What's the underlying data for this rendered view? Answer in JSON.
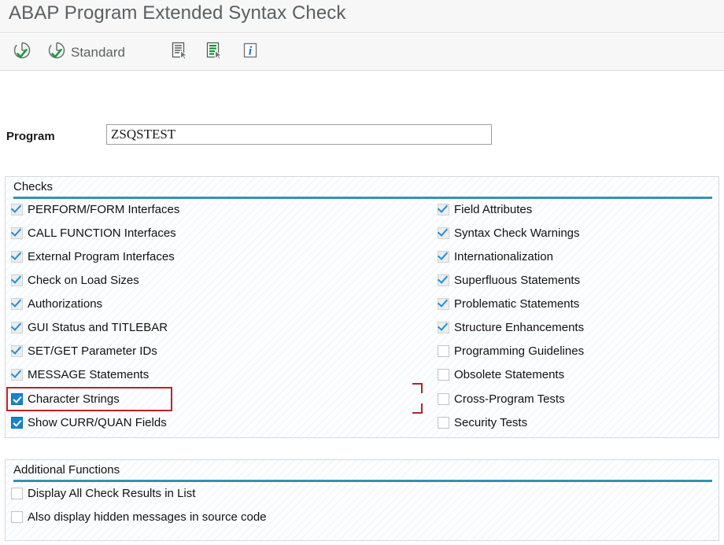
{
  "window": {
    "title": "ABAP Program Extended Syntax Check"
  },
  "toolbar": {
    "items": [
      {
        "name": "execute-check-button",
        "icon": "clock-check-icon",
        "label": ""
      },
      {
        "name": "standard-check-button",
        "icon": "clock-check-icon",
        "label": "Standard"
      },
      {
        "name": "display-list-button",
        "icon": "list-select-icon",
        "label": ""
      },
      {
        "name": "display-green-list-button",
        "icon": "green-list-select-icon",
        "label": ""
      },
      {
        "name": "information-button",
        "icon": "info-icon",
        "label": ""
      }
    ]
  },
  "program": {
    "label": "Program",
    "value": "ZSQSTEST",
    "placeholder": ""
  },
  "checks_panel": {
    "title": "Checks",
    "left_column": [
      {
        "label": "PERFORM/FORM Interfaces",
        "state": "checked"
      },
      {
        "label": "CALL FUNCTION Interfaces",
        "state": "checked"
      },
      {
        "label": "External Program Interfaces",
        "state": "checked"
      },
      {
        "label": "Check on Load Sizes",
        "state": "checked"
      },
      {
        "label": "Authorizations",
        "state": "checked"
      },
      {
        "label": "GUI Status and TITLEBAR",
        "state": "checked"
      },
      {
        "label": "SET/GET Parameter IDs",
        "state": "checked"
      },
      {
        "label": "MESSAGE Statements",
        "state": "checked"
      },
      {
        "label": "Character Strings",
        "state": "selected"
      },
      {
        "label": "Show CURR/QUAN Fields",
        "state": "selected"
      }
    ],
    "right_column": [
      {
        "label": "Field Attributes",
        "state": "checked"
      },
      {
        "label": "Syntax Check Warnings",
        "state": "checked"
      },
      {
        "label": "Internationalization",
        "state": "checked"
      },
      {
        "label": "Superfluous Statements",
        "state": "checked"
      },
      {
        "label": "Problematic Statements",
        "state": "checked"
      },
      {
        "label": "Structure Enhancements",
        "state": "checked"
      },
      {
        "label": "Programming Guidelines",
        "state": "unchecked"
      },
      {
        "label": "Obsolete Statements",
        "state": "unchecked"
      },
      {
        "label": "Cross-Program Tests",
        "state": "unchecked"
      },
      {
        "label": "Security Tests",
        "state": "unchecked"
      }
    ]
  },
  "additional_panel": {
    "title": "Additional Functions",
    "items": [
      {
        "label": "Display All Check Results in List",
        "state": "unchecked"
      },
      {
        "label": "Also display hidden messages in source code",
        "state": "unchecked"
      }
    ]
  },
  "annotation": {
    "highlight_color": "#c0202a",
    "target": "Character Strings"
  },
  "colors": {
    "accent_rule": "#3494ad",
    "checkbox_tick": "#1f8fd4",
    "checkbox_selected": "#1b84c6",
    "title_text": "#5a5f63",
    "toolbar_bg": "#f7f7f7"
  }
}
